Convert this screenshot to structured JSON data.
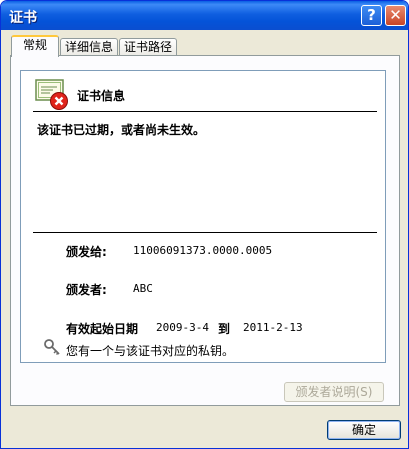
{
  "window": {
    "title": "证书",
    "help_glyph": "?",
    "close_glyph": "✕"
  },
  "tabs": [
    {
      "label": "常规",
      "active": true
    },
    {
      "label": "详细信息",
      "active": false
    },
    {
      "label": "证书路径",
      "active": false
    }
  ],
  "certificate": {
    "header": "证书信息",
    "status": "该证书已过期，或者尚未生效。",
    "issued_to_label": "颁发给:",
    "issued_to_value": "11006091373.0000.0005",
    "issued_by_label": "颁发者:",
    "issued_by_value": "ABC",
    "valid_label": "有效起始日期",
    "valid_from": "2009-3-4",
    "valid_to_label": "到",
    "valid_to": "2011-2-13",
    "private_key_note": "您有一个与该证书对应的私钥。"
  },
  "buttons": {
    "issuer_statement": "颁发者说明(S)",
    "ok": "确定"
  },
  "colors": {
    "title_bar": "#0a5fe3",
    "close_button": "#c84527",
    "error_red": "#e0241b"
  },
  "icons": [
    "help-icon",
    "close-icon",
    "certificate-error-icon",
    "key-icon"
  ]
}
